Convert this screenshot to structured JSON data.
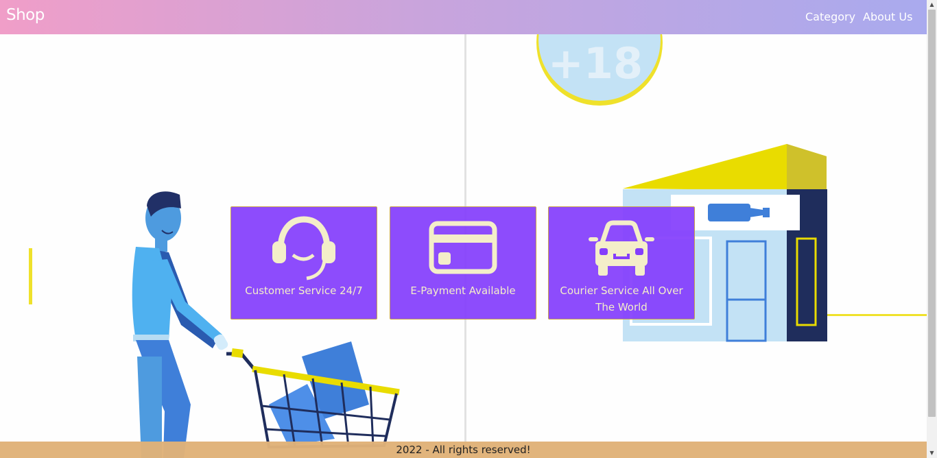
{
  "header": {
    "brand": "Shop",
    "nav": [
      {
        "label": "Category"
      },
      {
        "label": "About Us"
      }
    ]
  },
  "hero": {
    "badge_text": "+18"
  },
  "features": [
    {
      "label": "Customer Service 24/7",
      "icon": "headset-icon"
    },
    {
      "label": "E-Payment Available",
      "icon": "credit-card-icon"
    },
    {
      "label": "Courier Service All Over The World",
      "icon": "car-icon"
    }
  ],
  "footer": {
    "text": "2022 - All rights reserved!"
  },
  "colors": {
    "card_bg": "#843efc",
    "card_text": "#f4eec9",
    "footer_bg": "#e0b278",
    "header_gradient_start": "#f09ec8",
    "header_gradient_end": "#a9aaee"
  }
}
